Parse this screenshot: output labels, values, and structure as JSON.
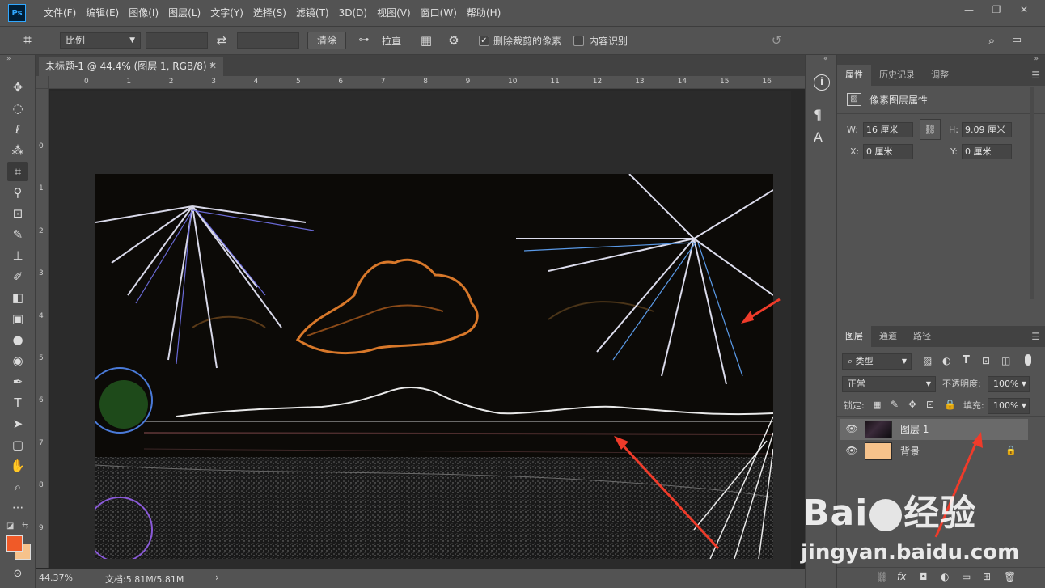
{
  "app": {
    "logo_text": "Ps"
  },
  "menu": [
    "文件(F)",
    "编辑(E)",
    "图像(I)",
    "图层(L)",
    "文字(Y)",
    "选择(S)",
    "滤镜(T)",
    "3D(D)",
    "视图(V)",
    "窗口(W)",
    "帮助(H)"
  ],
  "window_controls": {
    "minimize": "—",
    "restore": "❐",
    "close": "✕"
  },
  "options_bar": {
    "ratio_select": "比例",
    "ratio_w": "",
    "ratio_h": "",
    "clear_button": "清除",
    "straighten_label": "拉直",
    "delete_cropped_label": "删除裁剪的像素",
    "delete_cropped_checked": true,
    "content_aware_label": "内容识别",
    "content_aware_checked": false
  },
  "document": {
    "tab_title": "未标题-1 @ 44.4% (图层 1, RGB/8) *",
    "ruler_top": [
      "0",
      "1",
      "2",
      "3",
      "4",
      "5",
      "6",
      "7",
      "8",
      "9",
      "10",
      "11",
      "12",
      "13",
      "14",
      "15",
      "16"
    ],
    "ruler_left": [
      "0",
      "1",
      "2",
      "3",
      "4",
      "5",
      "6",
      "7",
      "8",
      "9"
    ],
    "zoom": "44.37%",
    "doc_size": "文档:5.81M/5.81M"
  },
  "properties_panel": {
    "tabs": [
      "属性",
      "历史记录",
      "调整"
    ],
    "title": "像素图层属性",
    "w_label": "W:",
    "w_value": "16 厘米",
    "h_label": "H:",
    "h_value": "9.09 厘米",
    "x_label": "X:",
    "x_value": "0 厘米",
    "y_label": "Y:",
    "y_value": "0 厘米"
  },
  "layers_panel": {
    "tabs": [
      "图层",
      "通道",
      "路径"
    ],
    "filter_label": "类型",
    "blend_mode": "正常",
    "opacity_label": "不透明度:",
    "opacity_value": "100%",
    "lock_label": "锁定:",
    "fill_label": "填充:",
    "fill_value": "100%",
    "layers": [
      {
        "name": "图层 1",
        "selected": true
      },
      {
        "name": "背景",
        "selected": false,
        "locked": true
      }
    ]
  },
  "watermark": {
    "brand": "Bai",
    "brand2": "经验",
    "url": "jingyan.baidu.com"
  },
  "colors": {
    "foreground": "#f05a28",
    "background": "#f6c28b",
    "accent": "#31a8ff",
    "arrow": "#ef3b2a"
  }
}
